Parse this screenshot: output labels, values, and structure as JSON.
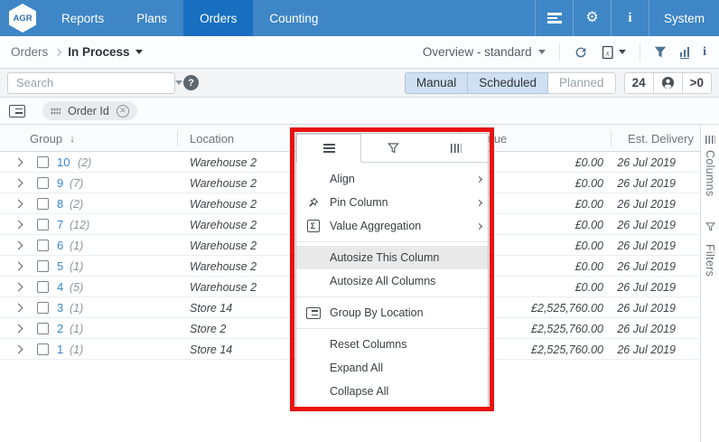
{
  "topbar": {
    "logo": "AGR",
    "tabs": [
      {
        "label": "Reports",
        "active": false
      },
      {
        "label": "Plans",
        "active": false
      },
      {
        "label": "Orders",
        "active": true
      },
      {
        "label": "Counting",
        "active": false
      }
    ],
    "system_label": "System",
    "icons": [
      "queue-icon",
      "gear-icon",
      "info-icon"
    ]
  },
  "breadcrumb": {
    "parent": "Orders",
    "current": "In Process"
  },
  "view_toolbar": {
    "view_selector": "Overview - standard",
    "icons": [
      "refresh-icon",
      "excel-export-icon",
      "filter-icon",
      "chart-icon",
      "info-icon"
    ]
  },
  "search": {
    "placeholder": "Search"
  },
  "filter_row": {
    "toggles": [
      {
        "label": "Manual",
        "active": true
      },
      {
        "label": "Scheduled",
        "active": true
      },
      {
        "label": "Planned",
        "active": false
      }
    ],
    "counters": {
      "left": "24",
      "middle_icon": "user-icon",
      "right": ">0"
    }
  },
  "group_panel": {
    "chip_label": "Order Id"
  },
  "grid": {
    "columns": [
      {
        "label": "Group",
        "sort": "desc"
      },
      {
        "label": "Location"
      },
      {
        "label": "Value"
      },
      {
        "label": "Est. Delivery"
      }
    ],
    "rows": [
      {
        "order_id": "10",
        "count": "(2)",
        "location": "Warehouse 2",
        "value": "£0.00",
        "est_delivery": "26 Jul 2019"
      },
      {
        "order_id": "9",
        "count": "(7)",
        "location": "Warehouse 2",
        "value": "£0.00",
        "est_delivery": "26 Jul 2019"
      },
      {
        "order_id": "8",
        "count": "(2)",
        "location": "Warehouse 2",
        "value": "£0.00",
        "est_delivery": "26 Jul 2019"
      },
      {
        "order_id": "7",
        "count": "(12)",
        "location": "Warehouse 2",
        "value": "£0.00",
        "est_delivery": "26 Jul 2019"
      },
      {
        "order_id": "6",
        "count": "(1)",
        "location": "Warehouse 2",
        "value": "£0.00",
        "est_delivery": "26 Jul 2019"
      },
      {
        "order_id": "5",
        "count": "(1)",
        "location": "Warehouse 2",
        "value": "£0.00",
        "est_delivery": "26 Jul 2019"
      },
      {
        "order_id": "4",
        "count": "(5)",
        "location": "Warehouse 2",
        "value": "£0.00",
        "est_delivery": "26 Jul 2019"
      },
      {
        "order_id": "3",
        "count": "(1)",
        "location": "Store 14",
        "value": "£2,525,760.00",
        "est_delivery": "26 Jul 2019"
      },
      {
        "order_id": "2",
        "count": "(1)",
        "location": "Store 2",
        "value": "£2,525,760.00",
        "est_delivery": "26 Jul 2019"
      },
      {
        "order_id": "1",
        "count": "(1)",
        "location": "Store 14",
        "value": "£2,525,760.00",
        "est_delivery": "26 Jul 2019"
      }
    ],
    "side_panel": [
      {
        "label": "Columns",
        "icon": "columns-icon"
      },
      {
        "label": "Filters",
        "icon": "filter-icon"
      }
    ]
  },
  "context_menu": {
    "tabs": [
      {
        "icon": "menu-tab-icon",
        "active": true
      },
      {
        "icon": "filter-tab-icon",
        "active": false
      },
      {
        "icon": "columns-tab-icon",
        "active": false
      }
    ],
    "items": [
      {
        "label": "Align",
        "submenu": true
      },
      {
        "label": "Pin Column",
        "icon": "pin-icon",
        "submenu": true
      },
      {
        "label": "Value Aggregation",
        "icon": "sigma-icon",
        "submenu": true
      },
      {
        "separator": true
      },
      {
        "label": "Autosize This Column",
        "highlighted": true
      },
      {
        "label": "Autosize All Columns"
      },
      {
        "separator": true
      },
      {
        "label": "Group By Location",
        "icon": "group-icon"
      },
      {
        "separator": true
      },
      {
        "label": "Reset Columns"
      },
      {
        "label": "Expand All"
      },
      {
        "label": "Collapse All"
      }
    ]
  },
  "colors": {
    "topbar": "#3e86c6",
    "topbar_active": "#186fc0",
    "link": "#3787cf",
    "toggle_active_bg": "#cfe0f2",
    "annotation": "#e9120e"
  }
}
